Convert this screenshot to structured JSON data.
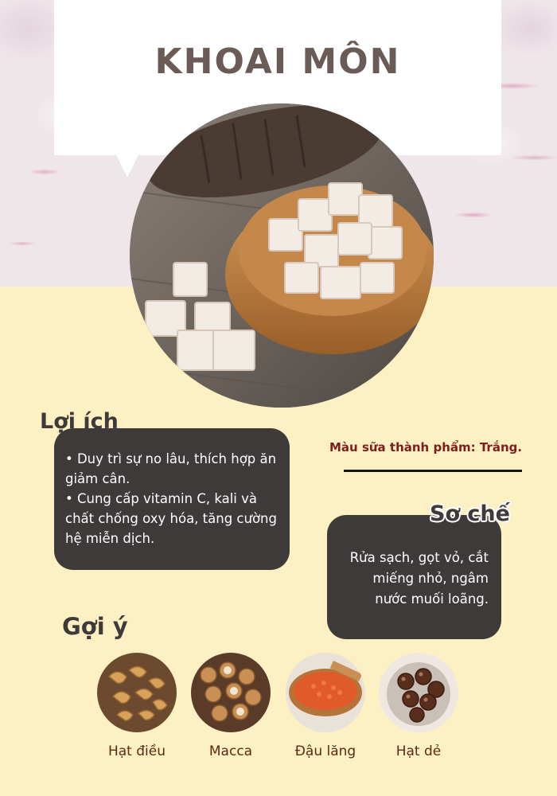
{
  "title": "KHOAI MÔN",
  "hero_image": "taro-cubes-in-wooden-bowl",
  "benefits": {
    "heading": "Lợi ích",
    "items": [
      "• Duy trì sự no lâu, thích hợp ăn giảm cân.",
      "• Cung cấp vitamin C, kali và chất chống oxy hóa, tăng cường hệ miễn dịch."
    ]
  },
  "milk_color": "Màu sữa thành phẩm: Trắng.",
  "preparation": {
    "heading": "Sơ chế",
    "text": "Rửa sạch, gọt vỏ, cắt miếng nhỏ, ngâm nước muối loãng."
  },
  "suggestions": {
    "heading": "Gợi ý",
    "items": [
      {
        "label": "Hạt điều",
        "image": "cashew-nuts"
      },
      {
        "label": "Macca",
        "image": "macadamia-nuts"
      },
      {
        "label": "Đậu lăng",
        "image": "red-lentils"
      },
      {
        "label": "Hạt dẻ",
        "image": "chestnuts"
      }
    ]
  },
  "colors": {
    "background": "#fdf0c2",
    "box": "#3f3a3a",
    "title": "#6b5b57",
    "accent": "#7a1e1e"
  }
}
